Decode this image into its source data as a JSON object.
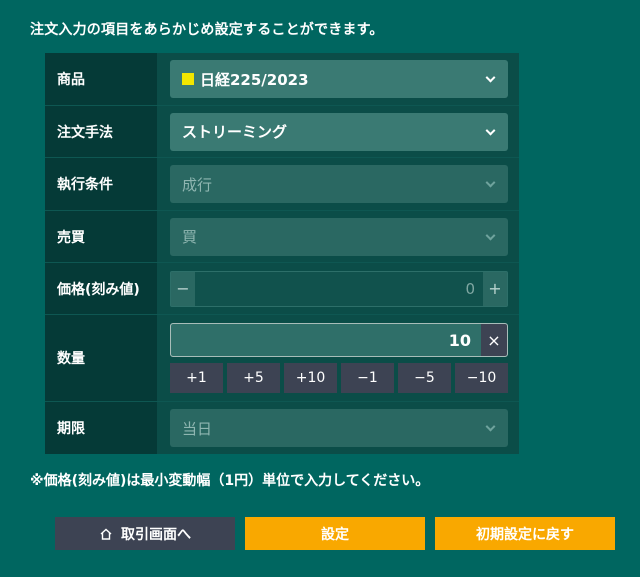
{
  "intro": "注文入力の項目をあらかじめ設定することができます。",
  "rows": {
    "product": {
      "label": "商品",
      "value": "日経225/2023",
      "swatch_color": "#f3e600"
    },
    "method": {
      "label": "注文手法",
      "value": "ストリーミング"
    },
    "condition": {
      "label": "執行条件",
      "value": "成行"
    },
    "side": {
      "label": "売買",
      "value": "買"
    },
    "price": {
      "label": "価格(刻み値)",
      "value": "0",
      "minus": "−",
      "plus": "+"
    },
    "quantity": {
      "label": "数量",
      "value": "10",
      "clear": "×",
      "quick": [
        "+1",
        "+5",
        "+10",
        "−1",
        "−5",
        "−10"
      ]
    },
    "expiry": {
      "label": "期限",
      "value": "当日"
    }
  },
  "note": "※価格(刻み値)は最小変動幅（1円）単位で入力してください。",
  "buttons": {
    "to_trade": "取引画面へ",
    "save": "設定",
    "reset": "初期設定に戻す"
  },
  "colors": {
    "accent": "#f9a800",
    "background": "#006660"
  }
}
